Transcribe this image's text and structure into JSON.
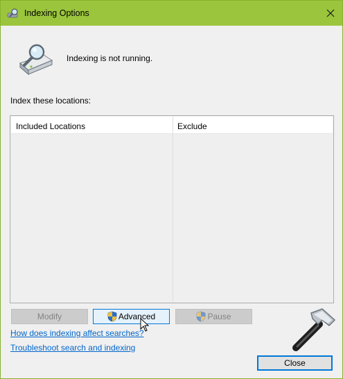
{
  "window": {
    "title": "Indexing Options",
    "close_icon": "close-icon"
  },
  "status": {
    "text": "Indexing is not running.",
    "icon": "indexing-drive-magnifier-icon"
  },
  "locations": {
    "label": "Index these locations:",
    "columns": [
      "Included Locations",
      "Exclude"
    ],
    "rows": []
  },
  "buttons": {
    "modify": "Modify",
    "advanced": "Advanced",
    "pause": "Pause",
    "close": "Close"
  },
  "links": {
    "how_affects": "How does indexing affect searches?",
    "troubleshoot": "Troubleshoot search and indexing"
  },
  "colors": {
    "titlebar": "#9ac53c",
    "window_bg": "#f0f0f0",
    "link": "#0066cc",
    "accent": "#0078d7"
  }
}
